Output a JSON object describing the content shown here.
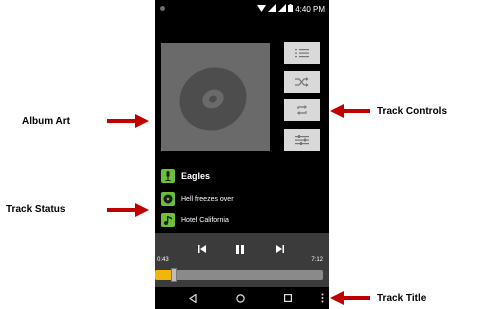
{
  "status_bar": {
    "time": "4:40 PM"
  },
  "track_info": {
    "artist": "Eagles",
    "album": "Hell freezes over",
    "title": "Hotel California"
  },
  "player": {
    "elapsed": "0:43",
    "duration": "7:12",
    "progress_fraction": 0.099
  },
  "callouts": {
    "album_art": "Album Art",
    "track_controls": "Track Controls",
    "track_status": "Track Status",
    "track_title": "Track Title"
  },
  "colors": {
    "arrow": "#c00000",
    "progress_fill": "#f2b705",
    "icon_green": "#6cbf3a"
  },
  "icons": {
    "controls": [
      "list-icon",
      "shuffle-icon",
      "repeat-icon",
      "equalizer-icon"
    ],
    "info": [
      "microphone-icon",
      "disc-icon",
      "music-note-icon"
    ],
    "player": [
      "previous-icon",
      "pause-icon",
      "next-icon"
    ],
    "nav": [
      "back-icon",
      "home-icon",
      "recents-icon",
      "menu-icon"
    ]
  }
}
